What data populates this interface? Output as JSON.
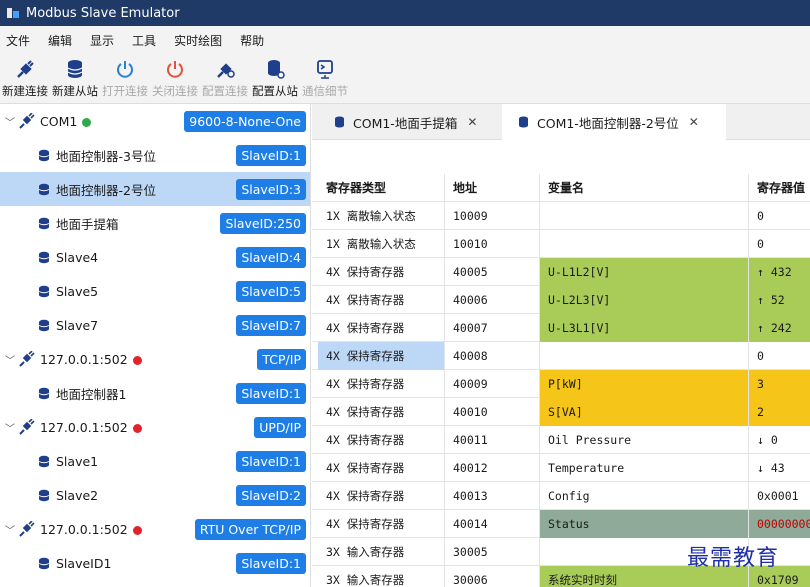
{
  "window": {
    "title": "Modbus Slave Emulator"
  },
  "menu": [
    "文件",
    "编辑",
    "显示",
    "工具",
    "实时绘图",
    "帮助"
  ],
  "toolbar": [
    {
      "label": "新建连接",
      "icon": "plug-icon",
      "enabled": true
    },
    {
      "label": "新建从站",
      "icon": "database-icon",
      "enabled": true
    },
    {
      "label": "打开连接",
      "icon": "power-icon",
      "enabled": false
    },
    {
      "label": "关闭连接",
      "icon": "power-off-icon",
      "enabled": false
    },
    {
      "label": "配置连接",
      "icon": "plug-config-icon",
      "enabled": false
    },
    {
      "label": "配置从站",
      "icon": "database-config-icon",
      "enabled": true
    },
    {
      "label": "通信细节",
      "icon": "terminal-icon",
      "enabled": false
    }
  ],
  "tree": [
    {
      "type": "connection",
      "label": "COM1",
      "status": "green",
      "badge": "9600-8-None-One"
    },
    {
      "type": "slave",
      "label": "地面控制器-3号位",
      "badge": "SlaveID:1"
    },
    {
      "type": "slave",
      "label": "地面控制器-2号位",
      "badge": "SlaveID:3",
      "selected": true
    },
    {
      "type": "slave",
      "label": "地面手提箱",
      "badge": "SlaveID:250"
    },
    {
      "type": "slave",
      "label": "Slave4",
      "badge": "SlaveID:4"
    },
    {
      "type": "slave",
      "label": "Slave5",
      "badge": "SlaveID:5"
    },
    {
      "type": "slave",
      "label": "Slave7",
      "badge": "SlaveID:7"
    },
    {
      "type": "connection",
      "label": "127.0.0.1:502",
      "status": "red",
      "badge": "TCP/IP"
    },
    {
      "type": "slave",
      "label": "地面控制器1",
      "badge": "SlaveID:1"
    },
    {
      "type": "connection",
      "label": "127.0.0.1:502",
      "status": "red",
      "badge": "UPD/IP"
    },
    {
      "type": "slave",
      "label": "Slave1",
      "badge": "SlaveID:1"
    },
    {
      "type": "slave",
      "label": "Slave2",
      "badge": "SlaveID:2"
    },
    {
      "type": "connection",
      "label": "127.0.0.1:502",
      "status": "red",
      "badge": "RTU Over TCP/IP"
    },
    {
      "type": "slave",
      "label": "SlaveID1",
      "badge": "SlaveID:1"
    }
  ],
  "tabs": [
    {
      "label": "COM1-地面手提箱",
      "active": false
    },
    {
      "label": "COM1-地面控制器-2号位",
      "active": true
    }
  ],
  "table": {
    "headers": [
      "寄存器类型",
      "地址",
      "变量名",
      "寄存器值"
    ],
    "rows": [
      {
        "type": "1X 离散输入状态",
        "addr": "10009",
        "name": "",
        "value": "0",
        "nameBg": "",
        "valBg": ""
      },
      {
        "type": "1X 离散输入状态",
        "addr": "10010",
        "name": "",
        "value": "0",
        "nameBg": "",
        "valBg": ""
      },
      {
        "type": "4X 保持寄存器",
        "addr": "40005",
        "name": "U-L1L2[V]",
        "value": "↑ 432",
        "nameBg": "#a9cc58",
        "valBg": "#a9cc58"
      },
      {
        "type": "4X 保持寄存器",
        "addr": "40006",
        "name": "U-L2L3[V]",
        "value": "↑ 52",
        "nameBg": "#a9cc58",
        "valBg": "#a9cc58"
      },
      {
        "type": "4X 保持寄存器",
        "addr": "40007",
        "name": "U-L3L1[V]",
        "value": "↑ 242",
        "nameBg": "#a9cc58",
        "valBg": "#a9cc58"
      },
      {
        "type": "4X 保持寄存器",
        "addr": "40008",
        "name": "",
        "value": "0",
        "nameBg": "",
        "valBg": "",
        "typeSel": true
      },
      {
        "type": "4X 保持寄存器",
        "addr": "40009",
        "name": "P[kW]",
        "value": "3",
        "nameBg": "#f5c519",
        "valBg": "#f5c519"
      },
      {
        "type": "4X 保持寄存器",
        "addr": "40010",
        "name": "S[VA]",
        "value": "2",
        "nameBg": "#f5c519",
        "valBg": "#f5c519"
      },
      {
        "type": "4X 保持寄存器",
        "addr": "40011",
        "name": "Oil Pressure",
        "value": "↓ 0",
        "nameBg": "",
        "valBg": ""
      },
      {
        "type": "4X 保持寄存器",
        "addr": "40012",
        "name": "Temperature",
        "value": "↓ 43",
        "nameBg": "",
        "valBg": ""
      },
      {
        "type": "4X 保持寄存器",
        "addr": "40013",
        "name": "Config",
        "value": "0x0001",
        "nameBg": "",
        "valBg": ""
      },
      {
        "type": "4X 保持寄存器",
        "addr": "40014",
        "name": "Status",
        "value": "00000000",
        "nameBg": "#8faa98",
        "valBg": "#8faa98",
        "valColor": "#c00000"
      },
      {
        "type": "3X 输入寄存器",
        "addr": "30005",
        "name": "",
        "value": "",
        "nameBg": "",
        "valBg": ""
      },
      {
        "type": "3X 输入寄存器",
        "addr": "30006",
        "name": "系统实时时刻",
        "value": "0x1709",
        "nameBg": "#a9cc58",
        "valBg": "#a9cc58"
      }
    ]
  },
  "watermark": "最需教育",
  "colors": {
    "titlebar": "#1f3a66",
    "badge": "#1e7ee6",
    "selection": "#bcd8f6"
  }
}
